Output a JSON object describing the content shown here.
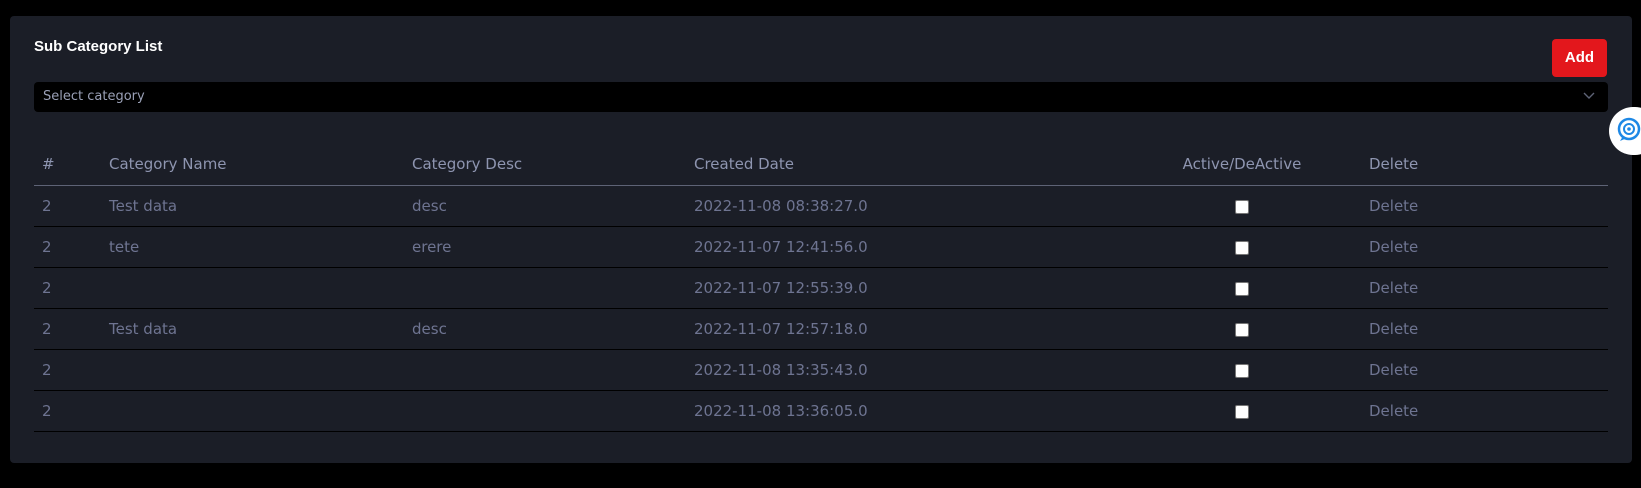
{
  "card": {
    "title": "Sub Category List",
    "add_label": "Add"
  },
  "select": {
    "placeholder": "Select category",
    "icon": "chevron-down-icon"
  },
  "table": {
    "headers": [
      "#",
      "Category Name",
      "Category Desc",
      "Created Date",
      "Active/DeActive",
      "Delete"
    ],
    "rows": [
      {
        "num": "2",
        "name": "Test data",
        "desc": "desc",
        "date": "2022-11-08 08:38:27.0",
        "active": false,
        "delete": "Delete"
      },
      {
        "num": "2",
        "name": "tete",
        "desc": "erere",
        "date": "2022-11-07 12:41:56.0",
        "active": false,
        "delete": "Delete"
      },
      {
        "num": "2",
        "name": "",
        "desc": "",
        "date": "2022-11-07 12:55:39.0",
        "active": false,
        "delete": "Delete"
      },
      {
        "num": "2",
        "name": "Test data",
        "desc": "desc",
        "date": "2022-11-07 12:57:18.0",
        "active": false,
        "delete": "Delete"
      },
      {
        "num": "2",
        "name": "",
        "desc": "",
        "date": "2022-11-08 13:35:43.0",
        "active": false,
        "delete": "Delete"
      },
      {
        "num": "2",
        "name": "",
        "desc": "",
        "date": "2022-11-08 13:36:05.0",
        "active": false,
        "delete": "Delete"
      }
    ]
  },
  "chat_widget": {
    "icon": "chat-bubble-icon"
  },
  "colors": {
    "page_bg": "#000000",
    "card_bg": "#1b1e27",
    "accent": "#e3171c",
    "header_text": "#8e95b0",
    "cell_text": "#6e7491"
  }
}
